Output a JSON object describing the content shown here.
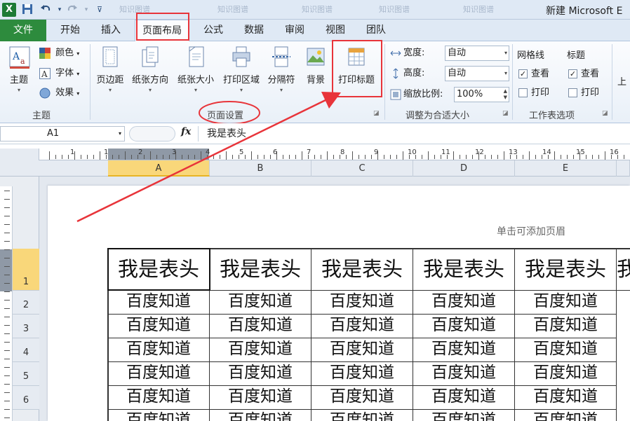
{
  "window": {
    "title": "新建 Microsoft E",
    "ghost_tabs": [
      "知识图谱",
      "知识图谱",
      "知识图谱",
      "知识图谱",
      "知识图谱"
    ]
  },
  "app_icon": "excel-icon",
  "quick_access": {
    "icons": [
      "save-icon",
      "undo-icon",
      "redo-icon",
      "customize-icon"
    ]
  },
  "ribbon_tabs": [
    {
      "label": "文件"
    },
    {
      "label": "开始"
    },
    {
      "label": "插入"
    },
    {
      "label": "页面布局",
      "active": true
    },
    {
      "label": "公式"
    },
    {
      "label": "数据"
    },
    {
      "label": "审阅"
    },
    {
      "label": "视图"
    },
    {
      "label": "团队"
    }
  ],
  "groups": {
    "themes": {
      "label": "主题",
      "main_button": "主题",
      "items": [
        {
          "label": "颜色"
        },
        {
          "label": "字体"
        },
        {
          "label": "效果"
        }
      ]
    },
    "page_setup": {
      "label": "页面设置",
      "buttons": [
        {
          "label": "页边距",
          "icon": "margins-icon"
        },
        {
          "label": "纸张方向",
          "icon": "orientation-icon"
        },
        {
          "label": "纸张大小",
          "icon": "paper-size-icon"
        },
        {
          "label": "打印区域",
          "icon": "print-area-icon"
        },
        {
          "label": "分隔符",
          "icon": "breaks-icon"
        },
        {
          "label": "背景",
          "icon": "background-icon"
        },
        {
          "label": "打印标题",
          "icon": "print-titles-icon"
        }
      ]
    },
    "scale_to_fit": {
      "label": "调整为合适大小",
      "width_label": "宽度:",
      "width_value": "自动",
      "height_label": "高度:",
      "height_value": "自动",
      "scale_label": "缩放比例:",
      "scale_value": "100%"
    },
    "sheet_options": {
      "label": "工作表选项",
      "gridlines_label": "网格线",
      "headings_label": "标题",
      "view_label": "查看",
      "print_label": "打印",
      "gridlines_view": true,
      "gridlines_print": false,
      "headings_view": true,
      "headings_print": false
    },
    "arrange_partial": "上"
  },
  "formula_bar": {
    "name_box": "A1",
    "fx": "fx",
    "content": "我是表头"
  },
  "columns": [
    "A",
    "B",
    "C",
    "D",
    "E"
  ],
  "rows": [
    "1",
    "2",
    "3",
    "4",
    "5",
    "6"
  ],
  "ruler_numbers_h": [
    "1",
    "1",
    "2",
    "3",
    "4",
    "5",
    "6",
    "7",
    "8",
    "9",
    "10",
    "11",
    "12",
    "13",
    "14",
    "15",
    "16"
  ],
  "page": {
    "header_hint": "单击可添加页眉"
  },
  "table": {
    "header_row": [
      "我是表头",
      "我是表头",
      "我是表头",
      "我是表头",
      "我是表头",
      "我"
    ],
    "data_rows": [
      [
        "百度知道",
        "百度知道",
        "百度知道",
        "百度知道",
        "百度知道"
      ],
      [
        "百度知道",
        "百度知道",
        "百度知道",
        "百度知道",
        "百度知道"
      ],
      [
        "百度知道",
        "百度知道",
        "百度知道",
        "百度知道",
        "百度知道"
      ],
      [
        "百度知道",
        "百度知道",
        "百度知道",
        "百度知道",
        "百度知道"
      ],
      [
        "百度知道",
        "百度知道",
        "百度知道",
        "百度知道",
        "百度知道"
      ],
      [
        "百度知道",
        "百度知道",
        "百度知道",
        "百度知道",
        "百度知道"
      ]
    ]
  },
  "annotation_color": "#e8343a"
}
